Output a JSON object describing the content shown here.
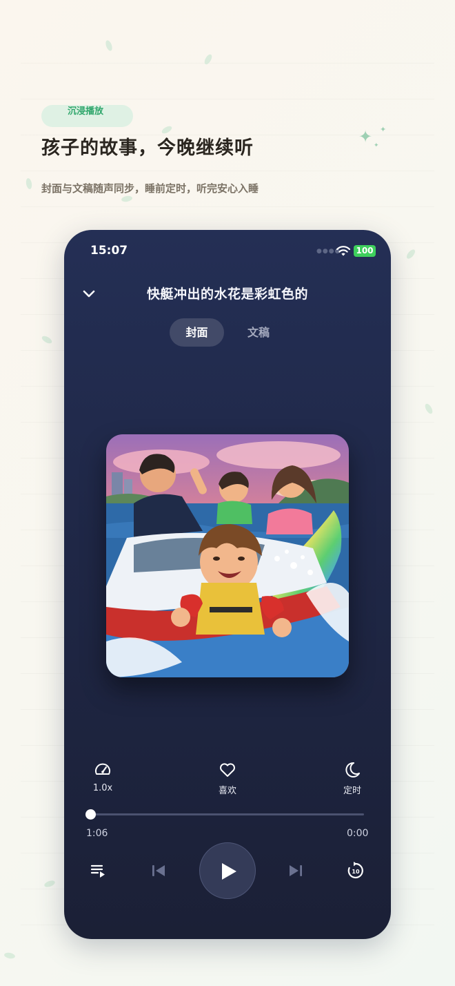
{
  "promo": {
    "tag": "沉浸播放",
    "headline": "孩子的故事，今晚继续听",
    "subline": "封面与文稿随声同步，睡前定时，听完安心入睡"
  },
  "status_bar": {
    "time": "15:07",
    "battery": "100"
  },
  "player": {
    "title": "快艇冲出的水花是彩虹色的",
    "tabs": [
      {
        "label": "封面",
        "active": true
      },
      {
        "label": "文稿",
        "active": false
      }
    ],
    "actions": {
      "speed": "1.0x",
      "like": "喜欢",
      "timer": "定时"
    },
    "progress": {
      "current": "1:06",
      "total": "0:00",
      "fraction": 0
    },
    "icons": [
      "chevron-down-icon",
      "speedometer-icon",
      "heart-icon",
      "moon-icon",
      "playlist-icon",
      "skip-previous-icon",
      "play-icon",
      "skip-next-icon",
      "replay-10-icon"
    ]
  },
  "colors": {
    "accent_green": "#2fa66b",
    "player_bg": "#1f2746",
    "battery_green": "#3ecf5c"
  }
}
